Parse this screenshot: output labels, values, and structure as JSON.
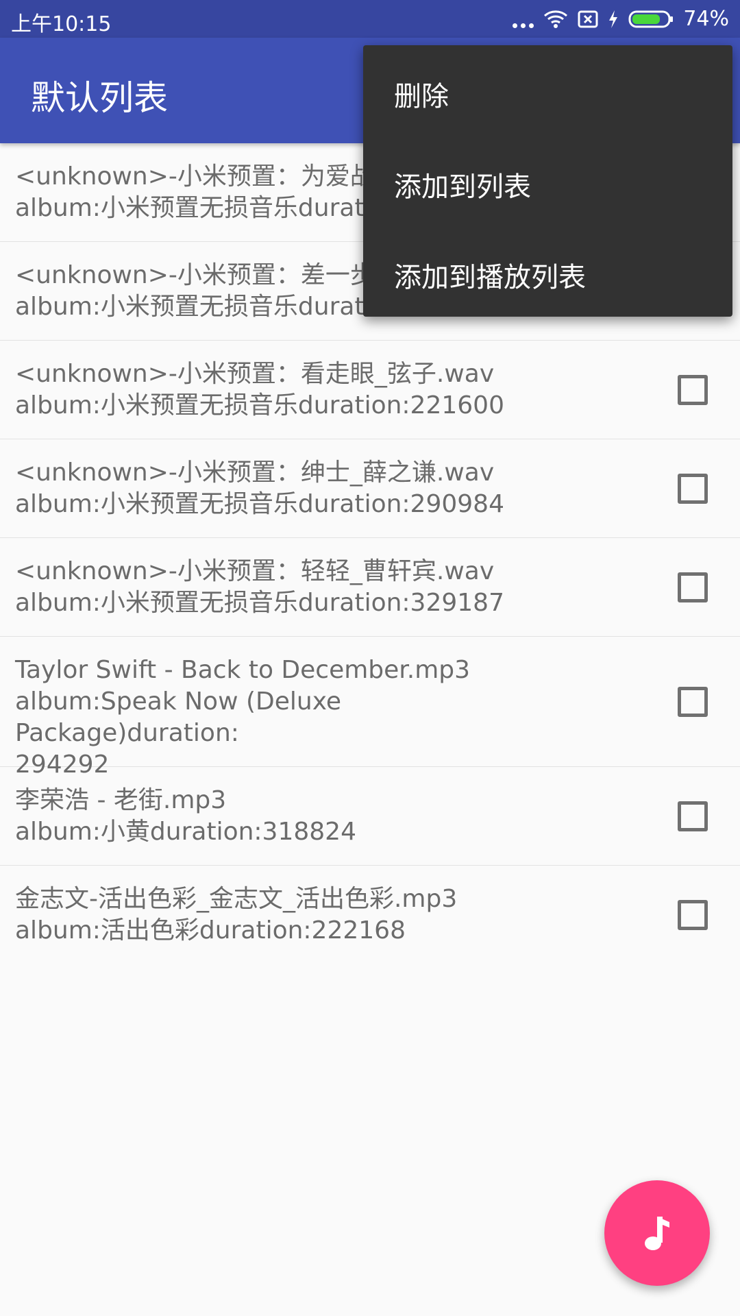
{
  "status_bar": {
    "time": "上午10:15",
    "battery_pct": "74%"
  },
  "app_bar": {
    "title": "默认列表"
  },
  "menu": {
    "items": [
      "删除",
      "添加到列表",
      "添加到播放列表"
    ]
  },
  "songs": [
    {
      "line1": "<unknown>-小米预置：为爱战",
      "line2": "album:小米预置无损音乐durat",
      "checked": false
    },
    {
      "line1": "<unknown>-小米预置：差一步",
      "line2": "album:小米预置无损音乐durat",
      "checked": false
    },
    {
      "line1": "<unknown>-小米预置：看走眼_弦子.wav",
      "line2": "album:小米预置无损音乐duration:221600",
      "checked": false
    },
    {
      "line1": "<unknown>-小米预置：绅士_薛之谦.wav",
      "line2": "album:小米预置无损音乐duration:290984",
      "checked": false
    },
    {
      "line1": "<unknown>-小米预置：轻轻_曹轩宾.wav",
      "line2": "album:小米预置无损音乐duration:329187",
      "checked": false
    },
    {
      "line1": "Taylor Swift - Back to December.mp3",
      "line2": "album:Speak Now (Deluxe Package)duration:",
      "line3": "294292",
      "checked": false
    },
    {
      "line1": "李荣浩 - 老街.mp3",
      "line2": "album:小黄duration:318824",
      "checked": false
    },
    {
      "line1": "金志文-活出色彩_金志文_活出色彩.mp3",
      "line2": "album:活出色彩duration:222168",
      "checked": false
    }
  ],
  "colors": {
    "primary": "#3f51b5",
    "primary_dark": "#3746a0",
    "accent": "#ff4081",
    "menu_bg": "#323232"
  },
  "icons": {
    "fab": "music-note-icon"
  }
}
